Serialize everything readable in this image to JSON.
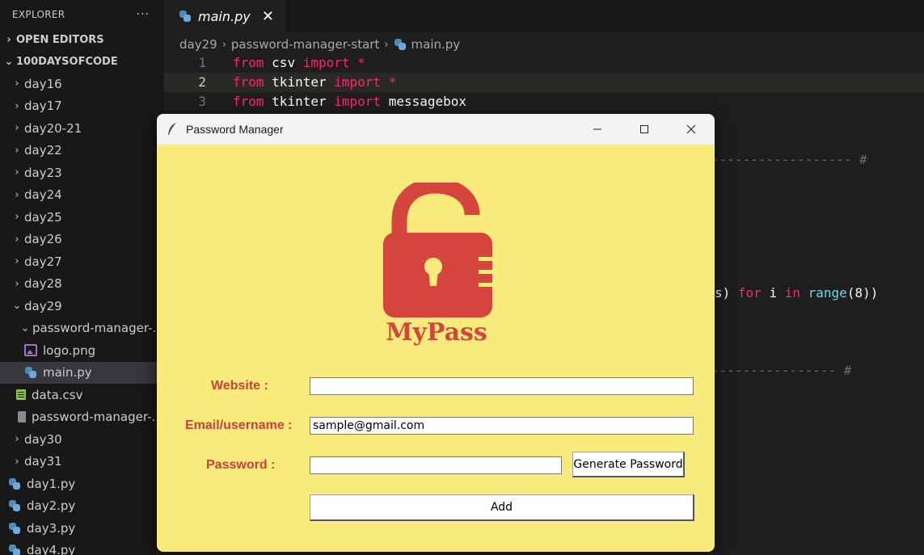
{
  "explorer": {
    "title": "EXPLORER",
    "more": "···",
    "sections": {
      "open_editors": "OPEN EDITORS",
      "workspace": "100DAYSOFCODE"
    },
    "items": [
      {
        "label": "day16"
      },
      {
        "label": "day17"
      },
      {
        "label": "day20-21"
      },
      {
        "label": "day22"
      },
      {
        "label": "day23"
      },
      {
        "label": "day24"
      },
      {
        "label": "day25"
      },
      {
        "label": "day26"
      },
      {
        "label": "day27"
      },
      {
        "label": "day28"
      },
      {
        "label": "day29"
      },
      {
        "label": "password-manager-..."
      },
      {
        "label": "logo.png"
      },
      {
        "label": "main.py"
      },
      {
        "label": "data.csv"
      },
      {
        "label": "password-manager-..."
      },
      {
        "label": "day30"
      },
      {
        "label": "day31"
      },
      {
        "label": "day1.py"
      },
      {
        "label": "day2.py"
      },
      {
        "label": "day3.py"
      },
      {
        "label": "day4.py"
      }
    ]
  },
  "editor": {
    "tab": {
      "label": "main.py",
      "close": "✕"
    },
    "breadcrumb": [
      "day29",
      "password-manager-start",
      "main.py"
    ],
    "lines": [
      {
        "number": "1",
        "kw1": "from",
        "mod": "csv",
        "kw2": "import",
        "rest": "*"
      },
      {
        "number": "2",
        "kw1": "from",
        "mod": "tkinter",
        "kw2": "import",
        "rest": "*"
      },
      {
        "number": "3",
        "kw1": "from",
        "mod": "tkinter",
        "kw2": "import",
        "rest": "messagebox"
      }
    ],
    "fragments": {
      "comment_end_1": "------------------ #",
      "code_a": "s)",
      "code_for": "for",
      "code_i": "i",
      "code_in": "in",
      "code_range": "range",
      "code_args": "(8))",
      "comment_end_2": "---------------- #"
    }
  },
  "tk_window": {
    "title": "Password Manager",
    "controls": {
      "minimize": "—",
      "maximize": "☐",
      "close": "✕"
    },
    "logo_text": "MyPass",
    "labels": {
      "website": "Website :",
      "email": "Email/username :",
      "password": "Password :"
    },
    "fields": {
      "website": "",
      "email": "sample@gmail.com",
      "password": ""
    },
    "buttons": {
      "generate": "Generate Password",
      "add": "Add"
    },
    "colors": {
      "background": "#f9ea7c",
      "label": "#c9403f",
      "logo": "#d6453d"
    }
  }
}
